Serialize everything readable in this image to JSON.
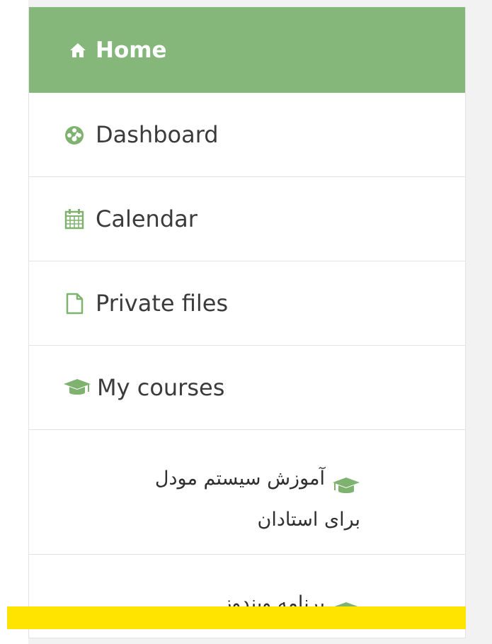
{
  "nav": {
    "home_label": "Home",
    "dashboard_label": "Dashboard",
    "calendar_label": "Calendar",
    "private_files_label": "Private files",
    "my_courses_label": "My courses",
    "courses": [
      {
        "label": "آموزش سیستم مودل برای استادان"
      },
      {
        "label": "برنامه ویندوز"
      }
    ]
  },
  "icons": {
    "home": "home-icon",
    "dashboard": "dashboard-icon",
    "calendar": "calendar-icon",
    "file": "file-icon",
    "courses": "graduation-cap-icon"
  },
  "colors": {
    "home_background": "#85b67a",
    "icon_green": "#7fb26e",
    "highlight": "#ffe400"
  }
}
